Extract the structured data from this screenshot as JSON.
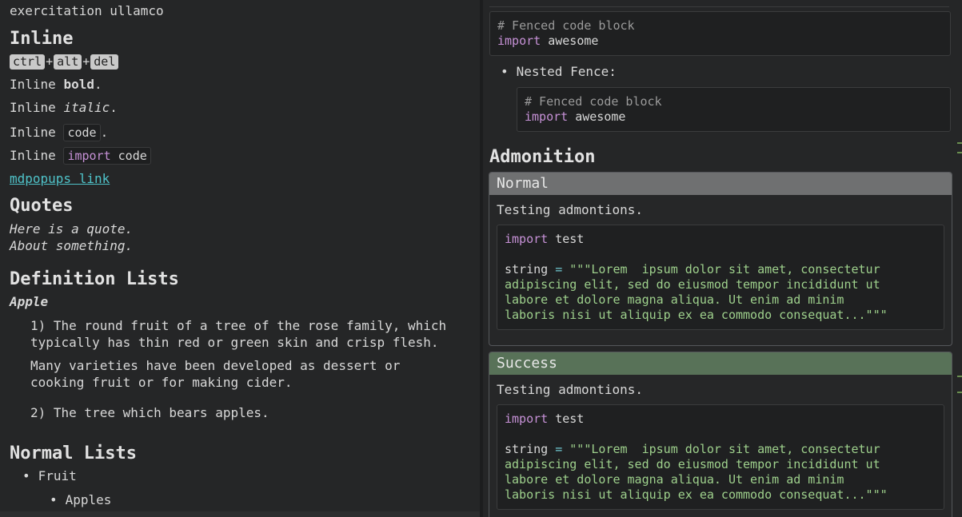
{
  "left": {
    "partial_top_text": "exercitation ullamco",
    "inline_heading": "Inline",
    "keys": [
      "ctrl",
      "alt",
      "del"
    ],
    "key_separator": "+",
    "inline_bold_prefix": "Inline ",
    "inline_bold_word": "bold",
    "inline_bold_suffix": ".",
    "inline_italic_prefix": "Inline ",
    "inline_italic_word": "italic",
    "inline_italic_suffix": ".",
    "inline_code_prefix": "Inline ",
    "inline_code_word": "code",
    "inline_code_suffix": ".",
    "inline_import_prefix": "Inline ",
    "inline_import_kw": "import",
    "inline_import_rest": " code",
    "link_text": "mdpopups link",
    "quotes_heading": "Quotes",
    "quote_line1": "Here is a quote.",
    "quote_line2": "About something.",
    "deflist_heading": "Definition Lists",
    "term": "Apple",
    "def1_line1": "1) The round fruit of a tree of the rose family, which",
    "def1_line2": "typically has thin red or green skin and crisp flesh.",
    "def1_p2_line1": "Many varieties have been developed as dessert or",
    "def1_p2_line2": "cooking fruit or for making cider.",
    "def2": "2) The tree which bears apples.",
    "normal_lists_heading": "Normal Lists",
    "list_item1": "Fruit",
    "list_item2": "Apples"
  },
  "right": {
    "fence1_comment": "# Fenced code block",
    "fence1_kw": "import",
    "fence1_rest": " awesome",
    "nested_label": "Nested Fence:",
    "fence2_comment": "# Fenced code block",
    "fence2_kw": "import",
    "fence2_rest": " awesome",
    "admonition_heading": "Admonition",
    "admonitions": [
      {
        "title": "Normal",
        "title_color": "#6f7071",
        "body": "Testing admontions.",
        "code_kw": "import",
        "code_rest": " test",
        "string_var": "string ",
        "string_eq": "=",
        "string_lines": [
          " \"\"\"Lorem  ipsum dolor sit amet, consectetur",
          "adipiscing elit, sed do eiusmod tempor incididunt ut",
          "labore et dolore magna aliqua. Ut enim ad minim",
          "laboris nisi ut aliquip ex ea commodo consequat...\"\"\""
        ]
      },
      {
        "title": "Success",
        "title_color": "#587258",
        "body": "Testing admontions.",
        "code_kw": "import",
        "code_rest": " test",
        "string_var": "string ",
        "string_eq": "=",
        "string_lines": [
          " \"\"\"Lorem  ipsum dolor sit amet, consectetur",
          "adipiscing elit, sed do eiusmod tempor incididunt ut",
          "labore et dolore magna aliqua. Ut enim ad minim",
          "laboris nisi ut aliquip ex ea commodo consequat...\"\"\""
        ]
      }
    ]
  }
}
